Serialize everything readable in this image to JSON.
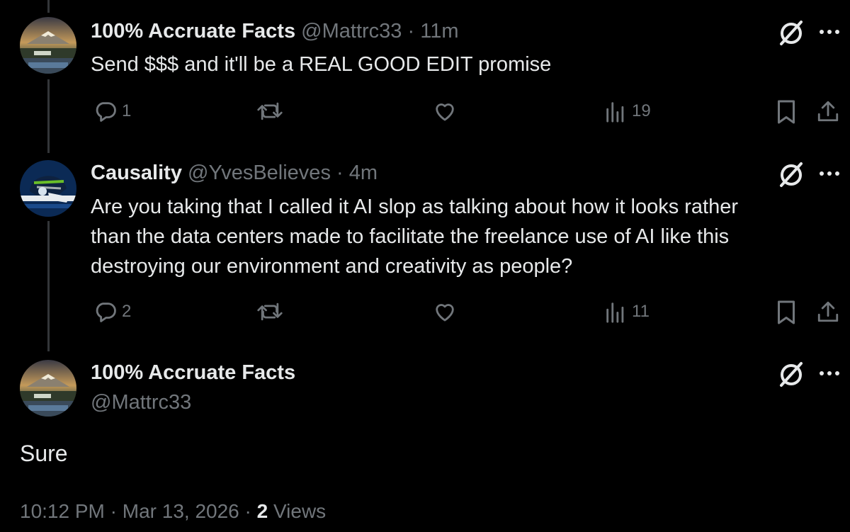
{
  "replies": [
    {
      "name": "100% Accruate Facts",
      "handle": "@Mattrc33",
      "time": "11m",
      "text_lines": [
        "Send $$$ and it'll be a REAL GOOD EDIT promise"
      ],
      "reply_count": "1",
      "retweet_count": "",
      "like_count": "",
      "view_count": "19"
    },
    {
      "name": "Causality",
      "handle": "@YvesBelieves",
      "time": "4m",
      "text_lines": [
        "Are you taking that I called it AI slop as talking about how it looks rather",
        "than the data centers made to facilitate the freelance use of AI like this",
        "destroying our environment and creativity as people?"
      ],
      "reply_count": "2",
      "retweet_count": "",
      "like_count": "",
      "view_count": "11"
    }
  ],
  "main_post": {
    "name": "100% Accruate Facts",
    "handle": "@Mattrc33",
    "text": "Sure",
    "time": "10:12 PM",
    "date": "Mar 13, 2026",
    "views_count": "2",
    "views_label": "Views"
  },
  "separator": "·",
  "icons": {
    "reply": "reply-icon",
    "retweet": "retweet-icon",
    "like": "heart-icon",
    "views": "views-icon",
    "bookmark": "bookmark-icon",
    "share": "share-icon",
    "grok": "grok-icon",
    "more": "more-icon"
  },
  "colors": {
    "background": "#000000",
    "text": "#e7e9ea",
    "muted": "#71767b",
    "thread_line": "#333639"
  }
}
